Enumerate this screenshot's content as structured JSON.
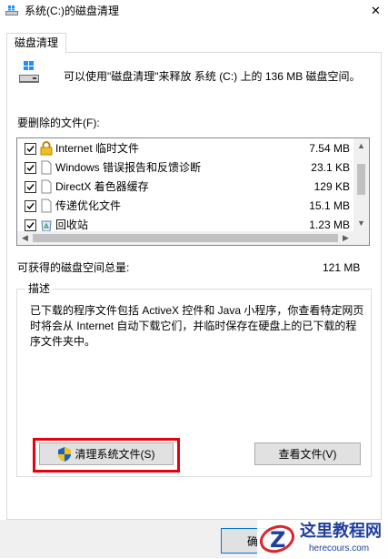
{
  "window": {
    "title": "系统(C:)的磁盘清理",
    "close_glyph": "✕"
  },
  "tab": {
    "label": "磁盘清理"
  },
  "info_text": "可以使用\"磁盘清理\"来释放 系统 (C:) 上的 136 MB 磁盘空间。",
  "files_label": "要删除的文件(F):",
  "files": [
    {
      "name": "Internet 临时文件",
      "size": "7.54 MB",
      "checked": true,
      "icon": "lock-icon"
    },
    {
      "name": "Windows 错误报告和反馈诊断",
      "size": "23.1 KB",
      "checked": true,
      "icon": "file-icon"
    },
    {
      "name": "DirectX 着色器缓存",
      "size": "129 KB",
      "checked": true,
      "icon": "file-icon"
    },
    {
      "name": "传递优化文件",
      "size": "15.1 MB",
      "checked": true,
      "icon": "file-icon"
    },
    {
      "name": "回收站",
      "size": "1.23 MB",
      "checked": true,
      "icon": "recycle-bin-icon"
    }
  ],
  "total": {
    "label": "可获得的磁盘空间总量:",
    "value": "121 MB"
  },
  "description": {
    "title": "描述",
    "text": "已下载的程序文件包括 ActiveX 控件和 Java 小程序，你查看特定网页时将会从 Internet 自动下载它们，并临时保存在硬盘上的已下载的程序文件夹中。"
  },
  "buttons": {
    "cleanup_system_files": "清理系统文件(S)",
    "view_files": "查看文件(V)",
    "ok": "确"
  },
  "watermark": {
    "title": "这里教程网",
    "url": "herecours.com"
  },
  "colors": {
    "highlight": "#e8000d",
    "accent": "#1f3f9e"
  }
}
